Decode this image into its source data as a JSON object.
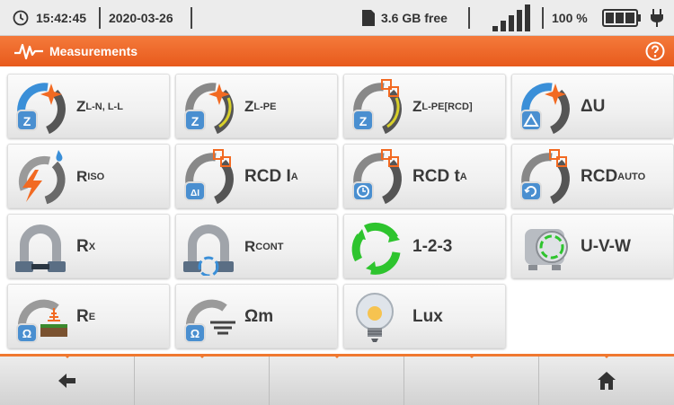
{
  "status": {
    "time": "15:42:45",
    "date": "2020-03-26",
    "storage": "3.6 GB free",
    "battery": "100 %"
  },
  "header": {
    "title": "Measurements"
  },
  "tiles": [
    {
      "label": "Z",
      "sub": "L-N, L-L"
    },
    {
      "label": "Z",
      "sub": "L-PE"
    },
    {
      "label": "Z",
      "sub": "L-PE[RCD]"
    },
    {
      "label": "ΔU",
      "sub": ""
    },
    {
      "label": "R",
      "sub": "ISO"
    },
    {
      "label": "RCD I",
      "sub": "A"
    },
    {
      "label": "RCD t",
      "sub": "A"
    },
    {
      "label": "RCD",
      "sub": "AUTO"
    },
    {
      "label": "R",
      "sub": "X"
    },
    {
      "label": "R",
      "sub": "CONT"
    },
    {
      "label": "1-2-3",
      "sub": ""
    },
    {
      "label": "U-V-W",
      "sub": ""
    },
    {
      "label": "R",
      "sub": "E"
    },
    {
      "label": "Ωm",
      "sub": ""
    },
    {
      "label": "Lux",
      "sub": ""
    }
  ],
  "icons": {
    "clock": "clock-icon",
    "sd": "sd-card-icon",
    "signal": "signal-bars-icon",
    "battery": "battery-icon",
    "plug": "plug-icon",
    "wave": "waveform-icon",
    "help": "help-icon",
    "back": "back-arrow-icon",
    "home": "home-icon"
  },
  "colors": {
    "accent": "#f0782f",
    "header": "#e85a1c",
    "icon_blue": "#3a8fd8",
    "icon_green": "#2ec42e"
  }
}
